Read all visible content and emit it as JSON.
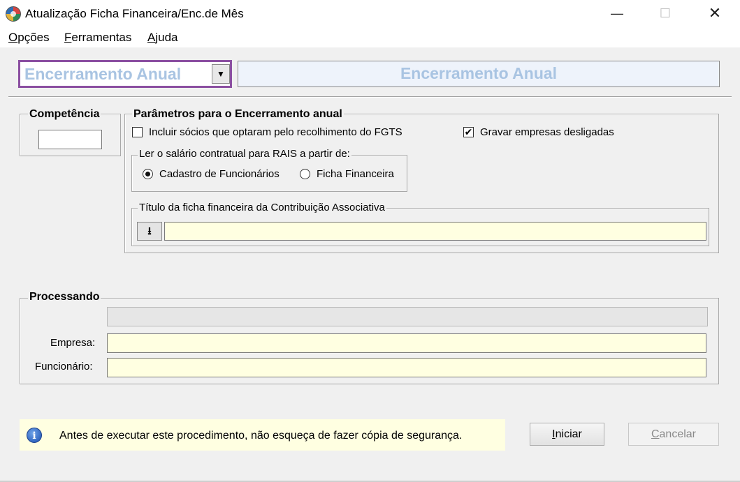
{
  "window": {
    "title": "Atualização Ficha Financeira/Enc.de Mês",
    "minimize_glyph": "—",
    "maximize_glyph": "☐",
    "close_glyph": "✕"
  },
  "menu": [
    {
      "mnemonic": "O",
      "rest": "pções"
    },
    {
      "mnemonic": "F",
      "rest": "erramentas"
    },
    {
      "mnemonic": "A",
      "rest": "juda"
    }
  ],
  "mode": {
    "selected": "Encerramento Anual",
    "banner": "Encerramento Anual",
    "accent_color": "#8b4fa1",
    "text_color": "#a9c4e2"
  },
  "competencia": {
    "label": "Competência",
    "value": ""
  },
  "params": {
    "label": "Parâmetros para o Encerramento anual",
    "socios_label": "Incluir sócios que optaram pelo recolhimento do FGTS",
    "socios_checked": false,
    "gravar_label": "Gravar empresas desligadas",
    "gravar_checked": true,
    "gravar_mark": "✔",
    "salario": {
      "label": "Ler o salário contratual para RAIS a partir de:",
      "options": [
        "Cadastro de Funcionários",
        "Ficha Financeira"
      ],
      "selected": "Cadastro de Funcionários"
    },
    "titulo": {
      "label": "Título da ficha financeira da Contribuição Associativa",
      "button_icon": "download-arrow-icon",
      "button_glyph": "⭳",
      "value": ""
    }
  },
  "processando": {
    "label": "Processando",
    "progress": 0,
    "empresa_label": "Empresa:",
    "empresa_value": "",
    "funcionario_label": "Funcionário:",
    "funcionario_value": ""
  },
  "info": {
    "icon": "info-icon",
    "icon_glyph": "i",
    "text": "Antes de executar este procedimento, não esqueça de fazer cópia de segurança."
  },
  "buttons": {
    "iniciar": {
      "mnemonic": "I",
      "rest": "niciar"
    },
    "cancelar": {
      "mnemonic": "C",
      "rest": "ancelar",
      "enabled": false
    }
  }
}
